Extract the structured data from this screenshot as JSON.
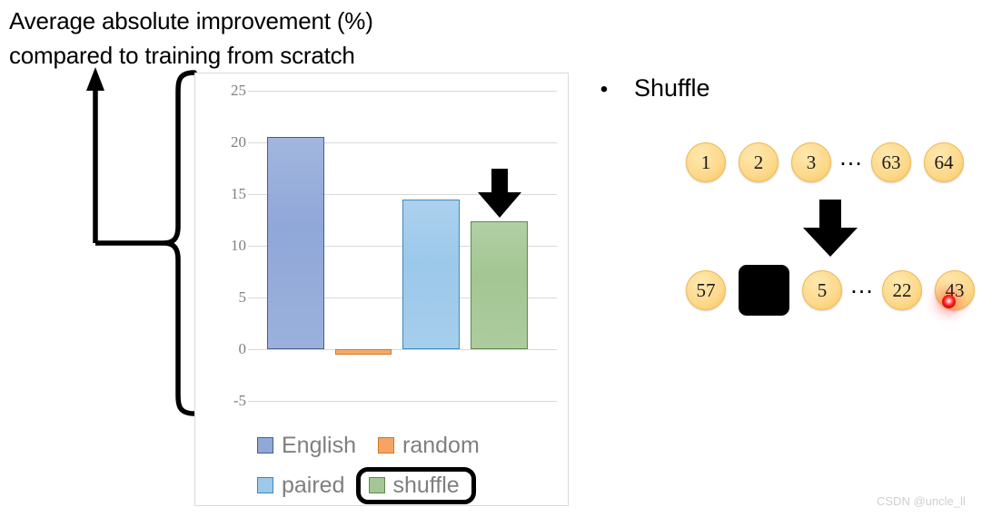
{
  "slide": {
    "title": "Average absolute improvement (%)\ncompared to training from scratch",
    "watermark": "CSDN @uncle_ll"
  },
  "annotations": {
    "brace_arrow_name": "upward-arrow-from-brace",
    "chart_down_arrow_name": "down-arrow-shuffle-bar"
  },
  "chart_data": {
    "type": "bar",
    "title": "Average absolute improvement (%) compared to training from scratch",
    "xlabel": "",
    "ylabel": "",
    "categories": [
      "English",
      "random",
      "paired",
      "shuffle"
    ],
    "values": [
      20.5,
      -0.3,
      14.5,
      12.4
    ],
    "colors": [
      "#90A8D8",
      "#F0A464",
      "#92C0E4",
      "#A3C694"
    ],
    "edge_colors": [
      "#42618E",
      "#D4761E",
      "#3E87BF",
      "#5E8A49"
    ],
    "ylim": [
      -7.5,
      26
    ],
    "yticks": [
      25,
      20,
      15,
      10,
      5,
      0,
      -5
    ],
    "ytick_labels": [
      "25",
      "20",
      "15",
      "10",
      "5",
      "0",
      "-5"
    ],
    "grid": true,
    "legend_position": "bottom",
    "highlighted_series": "shuffle"
  },
  "legend": {
    "rows": [
      [
        {
          "label": "English",
          "color": "#90A8D8",
          "edge": "#42618E",
          "highlighted": false
        },
        {
          "label": "random",
          "color": "#F5A464",
          "edge": "#D4761E",
          "highlighted": false
        }
      ],
      [
        {
          "label": "paired",
          "color": "#9CC8EA",
          "edge": "#3E87BF",
          "highlighted": false
        },
        {
          "label": "shuffle",
          "color": "#A3C694",
          "edge": "#5E8A49",
          "highlighted": true
        }
      ]
    ]
  },
  "right_panel": {
    "bullet_marker": "•",
    "bullet_text": "Shuffle",
    "row_before": [
      "1",
      "2",
      "3",
      "…",
      "63",
      "64"
    ],
    "row_after": [
      "57",
      "",
      "5",
      "…",
      "22",
      "43"
    ],
    "masked_index": 1,
    "ellipsis_index": 3,
    "token_fill": "#FCD98C",
    "token_border": "#EFB84B",
    "mask_color": "#000000",
    "laser_color": "#FF2A2A"
  }
}
